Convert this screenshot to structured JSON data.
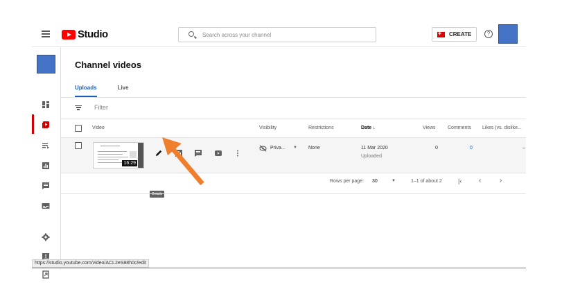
{
  "header": {
    "app_name": "Studio",
    "search_placeholder": "Search across your channel",
    "create_label": "CREATE",
    "help_symbol": "?"
  },
  "sidebar": {
    "items": [
      {
        "icon": "dashboard-icon"
      },
      {
        "icon": "content-icon",
        "active": true
      },
      {
        "icon": "playlists-icon"
      },
      {
        "icon": "analytics-icon"
      },
      {
        "icon": "comments-icon"
      },
      {
        "icon": "subtitles-icon"
      },
      {
        "icon": "settings-icon"
      },
      {
        "icon": "feedback-icon"
      },
      {
        "icon": "classic-studio-icon"
      }
    ]
  },
  "main": {
    "title": "Channel videos",
    "tabs": [
      {
        "label": "Uploads",
        "active": true
      },
      {
        "label": "Live",
        "active": false
      }
    ],
    "filter_placeholder": "Filter",
    "columns": {
      "video": "Video",
      "visibility": "Visibility",
      "restrictions": "Restrictions",
      "date": "Date ↓",
      "views": "Views",
      "comments": "Comments",
      "likes": "Likes (vs. dislike..."
    },
    "row": {
      "duration": "16:29",
      "visibility": "Priva...",
      "restrictions": "None",
      "date": "11 Mar 2020",
      "date_status": "Uploaded",
      "views": "0",
      "comments": "0",
      "likes": "–"
    },
    "tooltip": "Details",
    "pagination": {
      "rows_per_page_label": "Rows per page:",
      "rows_per_page_value": "30",
      "range": "1–1 of about 2"
    }
  },
  "status_bar": {
    "url": "https://studio.youtube.com/video/ACL2eS88h0c/edit"
  },
  "colors": {
    "accent_blue": "#1a5fb4",
    "youtube_red": "#ff0000",
    "annotation_arrow": "#f07f2d",
    "avatar": "#4472c4"
  }
}
